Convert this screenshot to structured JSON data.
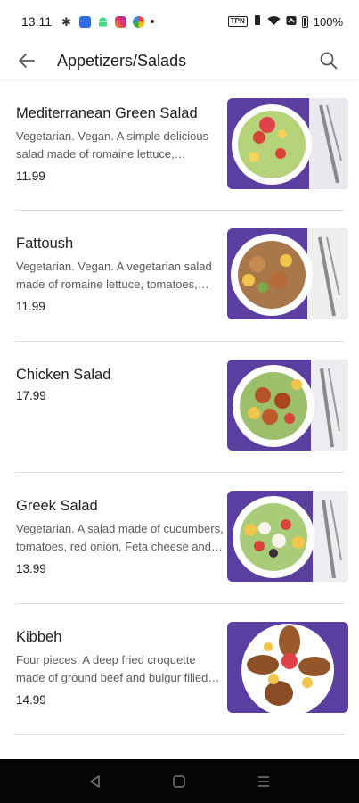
{
  "status_bar": {
    "time": "13:11",
    "network_badge": "TPN",
    "battery_percent": "100%"
  },
  "header": {
    "title": "Appetizers/Salads",
    "back_icon": "arrow-left-icon",
    "search_icon": "search-icon"
  },
  "menu_items": [
    {
      "name": "Mediterranean Green Salad",
      "description": "Vegetarian. Vegan. A simple delicious salad made of romaine lettuce, tomatoes, cucumbers and red onion.",
      "price": "11.99"
    },
    {
      "name": "Fattoush",
      "description": "Vegetarian. Vegan. A vegetarian salad made of romaine lettuce, tomatoes, cucumbers and toasted pita.",
      "price": "11.99"
    },
    {
      "name": "Chicken Salad",
      "description": "",
      "price": "17.99"
    },
    {
      "name": "Greek Salad",
      "description": "Vegetarian. A salad made of cucumbers, tomatoes, red onion, Feta cheese and olives.",
      "price": "13.99"
    },
    {
      "name": "Kibbeh",
      "description": "Four pieces. A deep fried croquette made of ground beef and bulgur filled with spiced meat.",
      "price": "14.99"
    }
  ],
  "colors": {
    "placemat_purple": "#5b3fa0",
    "divider": "#dcdcdc",
    "nav_bar": "#050505"
  }
}
